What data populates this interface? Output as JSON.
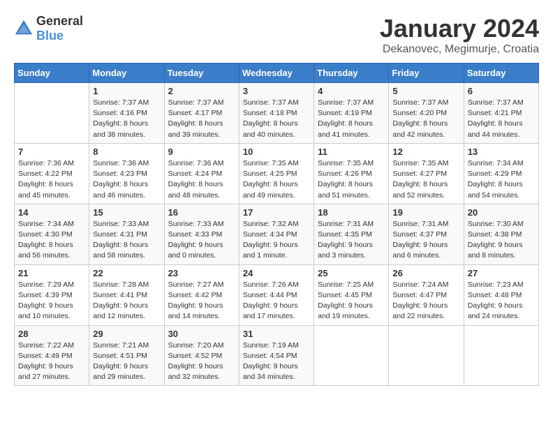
{
  "header": {
    "logo_general": "General",
    "logo_blue": "Blue",
    "title": "January 2024",
    "location": "Dekanovec, Megimurje, Croatia"
  },
  "weekdays": [
    "Sunday",
    "Monday",
    "Tuesday",
    "Wednesday",
    "Thursday",
    "Friday",
    "Saturday"
  ],
  "weeks": [
    [
      {
        "day": "",
        "sunrise": "",
        "sunset": "",
        "daylight": ""
      },
      {
        "day": "1",
        "sunrise": "Sunrise: 7:37 AM",
        "sunset": "Sunset: 4:16 PM",
        "daylight": "Daylight: 8 hours and 38 minutes."
      },
      {
        "day": "2",
        "sunrise": "Sunrise: 7:37 AM",
        "sunset": "Sunset: 4:17 PM",
        "daylight": "Daylight: 8 hours and 39 minutes."
      },
      {
        "day": "3",
        "sunrise": "Sunrise: 7:37 AM",
        "sunset": "Sunset: 4:18 PM",
        "daylight": "Daylight: 8 hours and 40 minutes."
      },
      {
        "day": "4",
        "sunrise": "Sunrise: 7:37 AM",
        "sunset": "Sunset: 4:19 PM",
        "daylight": "Daylight: 8 hours and 41 minutes."
      },
      {
        "day": "5",
        "sunrise": "Sunrise: 7:37 AM",
        "sunset": "Sunset: 4:20 PM",
        "daylight": "Daylight: 8 hours and 42 minutes."
      },
      {
        "day": "6",
        "sunrise": "Sunrise: 7:37 AM",
        "sunset": "Sunset: 4:21 PM",
        "daylight": "Daylight: 8 hours and 44 minutes."
      }
    ],
    [
      {
        "day": "7",
        "sunrise": "Sunrise: 7:36 AM",
        "sunset": "Sunset: 4:22 PM",
        "daylight": "Daylight: 8 hours and 45 minutes."
      },
      {
        "day": "8",
        "sunrise": "Sunrise: 7:36 AM",
        "sunset": "Sunset: 4:23 PM",
        "daylight": "Daylight: 8 hours and 46 minutes."
      },
      {
        "day": "9",
        "sunrise": "Sunrise: 7:36 AM",
        "sunset": "Sunset: 4:24 PM",
        "daylight": "Daylight: 8 hours and 48 minutes."
      },
      {
        "day": "10",
        "sunrise": "Sunrise: 7:35 AM",
        "sunset": "Sunset: 4:25 PM",
        "daylight": "Daylight: 8 hours and 49 minutes."
      },
      {
        "day": "11",
        "sunrise": "Sunrise: 7:35 AM",
        "sunset": "Sunset: 4:26 PM",
        "daylight": "Daylight: 8 hours and 51 minutes."
      },
      {
        "day": "12",
        "sunrise": "Sunrise: 7:35 AM",
        "sunset": "Sunset: 4:27 PM",
        "daylight": "Daylight: 8 hours and 52 minutes."
      },
      {
        "day": "13",
        "sunrise": "Sunrise: 7:34 AM",
        "sunset": "Sunset: 4:29 PM",
        "daylight": "Daylight: 8 hours and 54 minutes."
      }
    ],
    [
      {
        "day": "14",
        "sunrise": "Sunrise: 7:34 AM",
        "sunset": "Sunset: 4:30 PM",
        "daylight": "Daylight: 8 hours and 56 minutes."
      },
      {
        "day": "15",
        "sunrise": "Sunrise: 7:33 AM",
        "sunset": "Sunset: 4:31 PM",
        "daylight": "Daylight: 8 hours and 58 minutes."
      },
      {
        "day": "16",
        "sunrise": "Sunrise: 7:33 AM",
        "sunset": "Sunset: 4:33 PM",
        "daylight": "Daylight: 9 hours and 0 minutes."
      },
      {
        "day": "17",
        "sunrise": "Sunrise: 7:32 AM",
        "sunset": "Sunset: 4:34 PM",
        "daylight": "Daylight: 9 hours and 1 minute."
      },
      {
        "day": "18",
        "sunrise": "Sunrise: 7:31 AM",
        "sunset": "Sunset: 4:35 PM",
        "daylight": "Daylight: 9 hours and 3 minutes."
      },
      {
        "day": "19",
        "sunrise": "Sunrise: 7:31 AM",
        "sunset": "Sunset: 4:37 PM",
        "daylight": "Daylight: 9 hours and 6 minutes."
      },
      {
        "day": "20",
        "sunrise": "Sunrise: 7:30 AM",
        "sunset": "Sunset: 4:38 PM",
        "daylight": "Daylight: 9 hours and 8 minutes."
      }
    ],
    [
      {
        "day": "21",
        "sunrise": "Sunrise: 7:29 AM",
        "sunset": "Sunset: 4:39 PM",
        "daylight": "Daylight: 9 hours and 10 minutes."
      },
      {
        "day": "22",
        "sunrise": "Sunrise: 7:28 AM",
        "sunset": "Sunset: 4:41 PM",
        "daylight": "Daylight: 9 hours and 12 minutes."
      },
      {
        "day": "23",
        "sunrise": "Sunrise: 7:27 AM",
        "sunset": "Sunset: 4:42 PM",
        "daylight": "Daylight: 9 hours and 14 minutes."
      },
      {
        "day": "24",
        "sunrise": "Sunrise: 7:26 AM",
        "sunset": "Sunset: 4:44 PM",
        "daylight": "Daylight: 9 hours and 17 minutes."
      },
      {
        "day": "25",
        "sunrise": "Sunrise: 7:25 AM",
        "sunset": "Sunset: 4:45 PM",
        "daylight": "Daylight: 9 hours and 19 minutes."
      },
      {
        "day": "26",
        "sunrise": "Sunrise: 7:24 AM",
        "sunset": "Sunset: 4:47 PM",
        "daylight": "Daylight: 9 hours and 22 minutes."
      },
      {
        "day": "27",
        "sunrise": "Sunrise: 7:23 AM",
        "sunset": "Sunset: 4:48 PM",
        "daylight": "Daylight: 9 hours and 24 minutes."
      }
    ],
    [
      {
        "day": "28",
        "sunrise": "Sunrise: 7:22 AM",
        "sunset": "Sunset: 4:49 PM",
        "daylight": "Daylight: 9 hours and 27 minutes."
      },
      {
        "day": "29",
        "sunrise": "Sunrise: 7:21 AM",
        "sunset": "Sunset: 4:51 PM",
        "daylight": "Daylight: 9 hours and 29 minutes."
      },
      {
        "day": "30",
        "sunrise": "Sunrise: 7:20 AM",
        "sunset": "Sunset: 4:52 PM",
        "daylight": "Daylight: 9 hours and 32 minutes."
      },
      {
        "day": "31",
        "sunrise": "Sunrise: 7:19 AM",
        "sunset": "Sunset: 4:54 PM",
        "daylight": "Daylight: 9 hours and 34 minutes."
      },
      {
        "day": "",
        "sunrise": "",
        "sunset": "",
        "daylight": ""
      },
      {
        "day": "",
        "sunrise": "",
        "sunset": "",
        "daylight": ""
      },
      {
        "day": "",
        "sunrise": "",
        "sunset": "",
        "daylight": ""
      }
    ]
  ]
}
